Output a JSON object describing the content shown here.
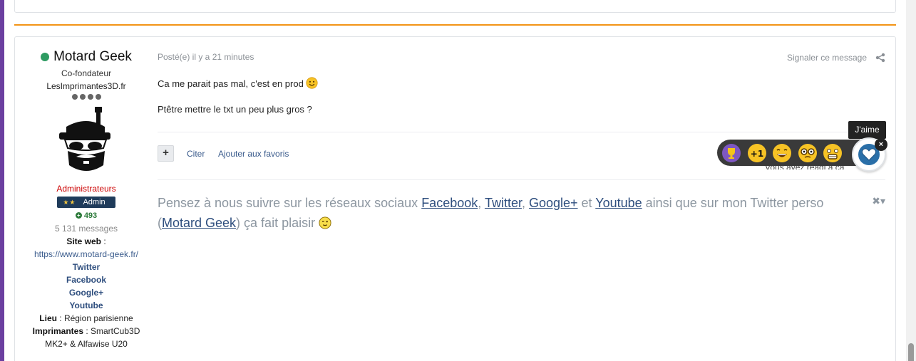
{
  "author": {
    "name": "Motard Geek",
    "title": "Co-fondateur",
    "site_name": "LesImprimantes3D.fr",
    "group": "Administrateurs",
    "badge": "Admin",
    "badge_stars": "★★",
    "reputation": "493",
    "messages": "5 131 messages",
    "site_web_label": "Site web",
    "site_web_sep": " :",
    "site_web_url": "https://www.motard-geek.fr/",
    "links": [
      "Twitter",
      "Facebook",
      "Google+",
      "Youtube"
    ],
    "lieu_label": "Lieu",
    "lieu_value": " : Région parisienne",
    "imprimantes_label": "Imprimantes",
    "imprimantes_value": " : SmartCub3D",
    "imprimantes_value2": "MK2+ & Alfawise U20",
    "status_color": "#2e9b62"
  },
  "post": {
    "meta": "Posté(e) il y a 21 minutes",
    "report": "Signaler ce message",
    "line1": "Ca me parait pas mal, c'est en prod",
    "line2": "Ptêtre mettre le txt un peu plus gros ?"
  },
  "actions": {
    "plus": "+",
    "quote": "Citer",
    "favorite": "Ajouter aux favoris",
    "reacted_text": "Vous avez réagi à ça",
    "like_tooltip": "J'aime",
    "close": "×"
  },
  "reactions": [
    "trophy-icon",
    "plus-one-icon",
    "laugh-icon",
    "nerd-icon",
    "scared-icon"
  ],
  "signature": {
    "t1": "Pensez à nous suivre sur les réseaux sociaux ",
    "facebook": "Facebook",
    "t2": ", ",
    "twitter": "Twitter",
    "t3": ", ",
    "google": "Google+",
    "t4": " et ",
    "youtube": "Youtube",
    "t5": " ainsi que sur mon Twitter perso (",
    "motard": "Motard Geek",
    "t6": ") ça fait plaisir ",
    "controls": "✖▾"
  },
  "colors": {
    "accent_orange": "#f29416",
    "link_blue": "#2e4e7e",
    "admin_red": "#cc0000",
    "badge_navy": "#1f3b5a"
  }
}
